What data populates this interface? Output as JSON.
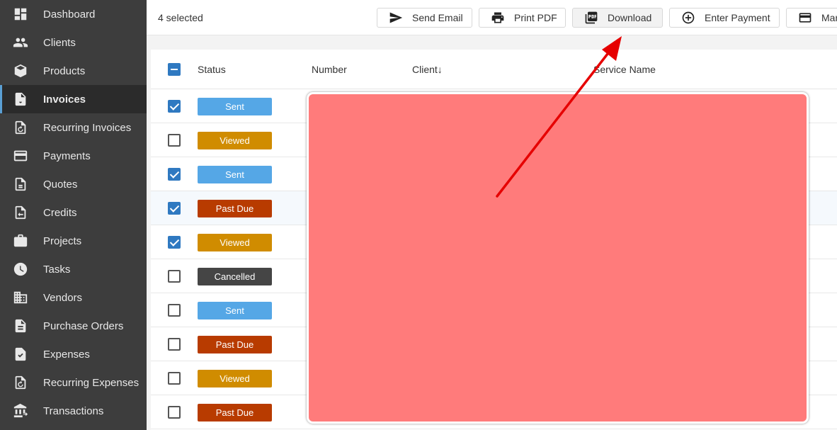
{
  "sidebar": {
    "items": [
      {
        "label": "Dashboard",
        "icon": "dashboard-icon",
        "active": false
      },
      {
        "label": "Clients",
        "icon": "clients-icon",
        "active": false
      },
      {
        "label": "Products",
        "icon": "products-icon",
        "active": false
      },
      {
        "label": "Invoices",
        "icon": "invoices-icon",
        "active": true
      },
      {
        "label": "Recurring Invoices",
        "icon": "recurring-invoices-icon",
        "active": false
      },
      {
        "label": "Payments",
        "icon": "payments-icon",
        "active": false
      },
      {
        "label": "Quotes",
        "icon": "quotes-icon",
        "active": false
      },
      {
        "label": "Credits",
        "icon": "credits-icon",
        "active": false
      },
      {
        "label": "Projects",
        "icon": "projects-icon",
        "active": false
      },
      {
        "label": "Tasks",
        "icon": "tasks-icon",
        "active": false
      },
      {
        "label": "Vendors",
        "icon": "vendors-icon",
        "active": false
      },
      {
        "label": "Purchase Orders",
        "icon": "purchase-orders-icon",
        "active": false
      },
      {
        "label": "Expenses",
        "icon": "expenses-icon",
        "active": false
      },
      {
        "label": "Recurring Expenses",
        "icon": "recurring-expenses-icon",
        "active": false
      },
      {
        "label": "Transactions",
        "icon": "transactions-icon",
        "active": false
      }
    ]
  },
  "toolbar": {
    "selected_text": "4 selected",
    "buttons": [
      {
        "label": "Send Email",
        "icon": "send-icon"
      },
      {
        "label": "Print PDF",
        "icon": "print-icon"
      },
      {
        "label": "Download",
        "icon": "pdf-download-icon"
      },
      {
        "label": "Enter Payment",
        "icon": "add-circle-icon"
      },
      {
        "label": "Mar",
        "icon": "card-icon"
      }
    ]
  },
  "table": {
    "columns": {
      "status": "Status",
      "number": "Number",
      "client": "Client",
      "service": "Service Name"
    },
    "rows": [
      {
        "checked": true,
        "status": "Sent"
      },
      {
        "checked": false,
        "status": "Viewed"
      },
      {
        "checked": true,
        "status": "Sent"
      },
      {
        "checked": true,
        "status": "Past Due"
      },
      {
        "checked": true,
        "status": "Viewed"
      },
      {
        "checked": false,
        "status": "Cancelled"
      },
      {
        "checked": false,
        "status": "Sent"
      },
      {
        "checked": false,
        "status": "Past Due"
      },
      {
        "checked": false,
        "status": "Viewed"
      },
      {
        "checked": false,
        "status": "Past Due"
      }
    ]
  },
  "status_colors": {
    "Sent": "#55a7e6",
    "Viewed": "#d08c00",
    "Past Due": "#b83b00",
    "Cancelled": "#454545"
  },
  "colors": {
    "sidebar_bg": "#3d3d3d",
    "accent": "#2f79c1",
    "redaction": "#ff7b7b",
    "arrow": "#e60000"
  }
}
